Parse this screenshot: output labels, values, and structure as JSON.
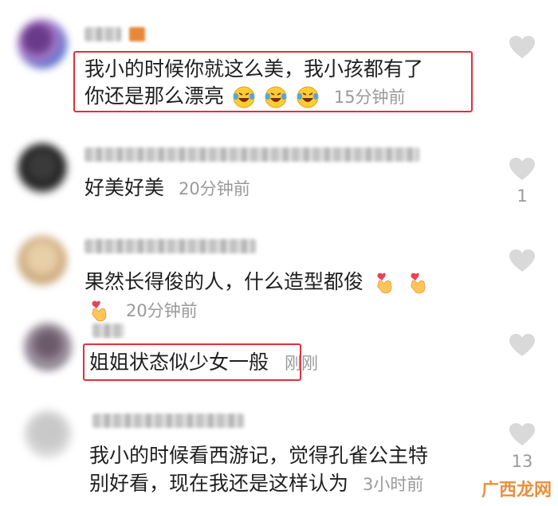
{
  "comments": [
    {
      "lines": [
        "我小的时候你就这么美，我小孩都有了",
        "你还是那么漂亮"
      ],
      "time": "15分钟前",
      "likes": "",
      "emojis": [
        "laughing-crying-emoji",
        "laughing-crying-emoji",
        "laughing-crying-emoji"
      ]
    },
    {
      "lines": [
        "好美好美"
      ],
      "time": "20分钟前",
      "likes": "1"
    },
    {
      "lines": [
        "果然长得俊的人，什么造型都俊"
      ],
      "time": "20分钟前",
      "likes": "",
      "emojis": [
        "finger-heart-emoji",
        "finger-heart-emoji",
        "finger-heart-emoji"
      ]
    },
    {
      "lines": [
        "姐姐状态似少女一般"
      ],
      "time": "刚刚",
      "likes": ""
    },
    {
      "lines": [
        "我小的时候看西游记，觉得孔雀公主特",
        "别好看，现在我还是这样认为"
      ],
      "time": "3小时前",
      "likes": "13"
    }
  ],
  "watermark": "广西龙网",
  "colors": {
    "highlight": "#e0303a",
    "time": "#9a9a9a",
    "heart": "#d9d9d9",
    "watermark": "#e8832a"
  }
}
